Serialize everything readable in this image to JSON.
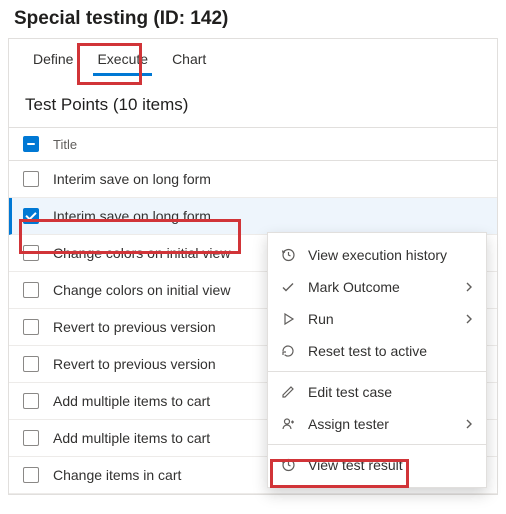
{
  "page": {
    "title": "Special testing (ID: 142)"
  },
  "tabs": {
    "define": "Define",
    "execute": "Execute",
    "chart": "Chart"
  },
  "section": {
    "heading": "Test Points (10 items)",
    "title_col": "Title"
  },
  "rows": [
    {
      "title": "Interim save on long form"
    },
    {
      "title": "Interim save on long form"
    },
    {
      "title": "Change colors on initial view"
    },
    {
      "title": "Change colors on initial view"
    },
    {
      "title": "Revert to previous version"
    },
    {
      "title": "Revert to previous version"
    },
    {
      "title": "Add multiple items to cart"
    },
    {
      "title": "Add multiple items to cart"
    },
    {
      "title": "Change items in cart"
    }
  ],
  "menu": {
    "view_history": "View execution history",
    "mark_outcome": "Mark Outcome",
    "run": "Run",
    "reset": "Reset test to active",
    "edit": "Edit test case",
    "assign": "Assign tester",
    "view_result": "View test result"
  }
}
